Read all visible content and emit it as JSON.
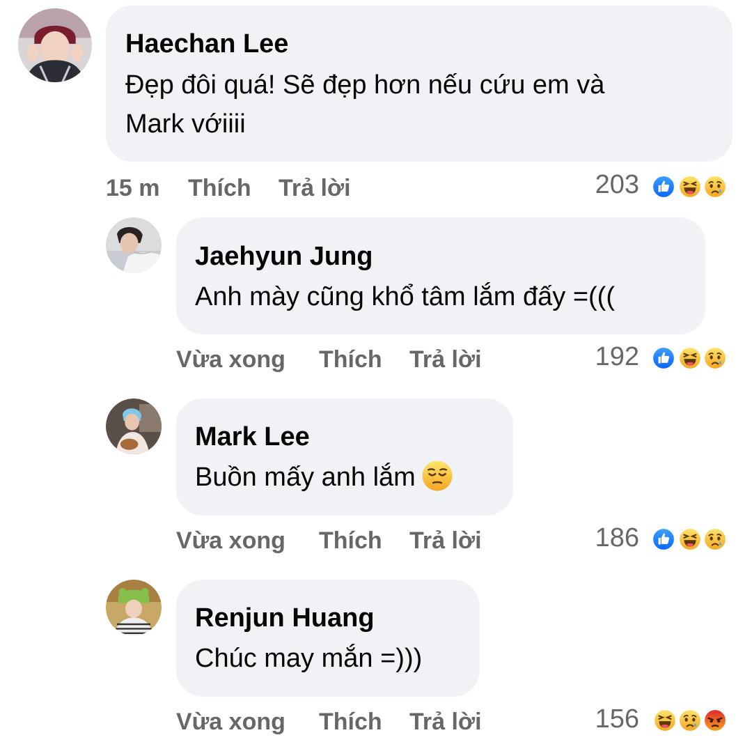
{
  "comments": [
    {
      "author": "Haechan Lee",
      "text_line1": "Đẹp đôi quá! Sẽ đẹp hơn nếu cứu em và",
      "text_line2": "Mark vớiiii",
      "time": "15 m",
      "like_label": "Thích",
      "reply_label": "Trả lời",
      "reaction_count": "203",
      "reactions": [
        "like-icon",
        "haha-icon",
        "sad-icon"
      ]
    },
    {
      "author": "Jaehyun Jung",
      "text": "Anh mày cũng khổ tâm lắm đấy =(((",
      "time": "Vừa xong",
      "like_label": "Thích",
      "reply_label": "Trả lời",
      "reaction_count": "192",
      "reactions": [
        "like-icon",
        "haha-icon",
        "sad-icon"
      ]
    },
    {
      "author": "Mark Lee",
      "text": "Buồn mấy anh lắm",
      "text_emoji": "pensive-face-icon",
      "time": "Vừa xong",
      "like_label": "Thích",
      "reply_label": "Trả lời",
      "reaction_count": "186",
      "reactions": [
        "like-icon",
        "haha-icon",
        "sad-icon"
      ]
    },
    {
      "author": "Renjun Huang",
      "text": "Chúc may mắn =)))",
      "time": "Vừa xong",
      "like_label": "Thích",
      "reply_label": "Trả lời",
      "reaction_count": "156",
      "reactions": [
        "haha-icon",
        "sad-icon",
        "angry-icon"
      ]
    }
  ],
  "colors": {
    "bubble": "#f0f2f5",
    "meta_text": "#65676b",
    "like_blue": "#1877f2",
    "emoji_yellow": "#f7b928",
    "angry_red": "#e9710f"
  }
}
